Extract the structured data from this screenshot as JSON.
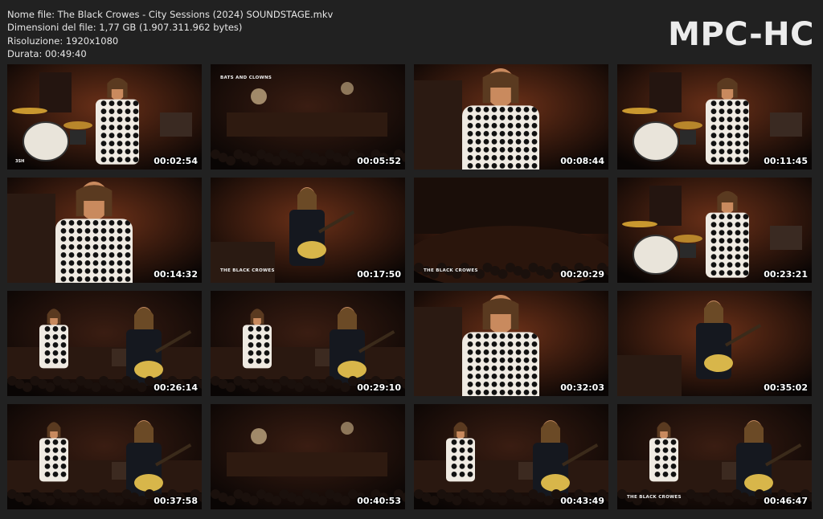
{
  "file_info": {
    "name_line": "Nome file: The Black Crowes - City Sessions (2024) SOUNDSTAGE.mkv",
    "size_line": "Dimensioni del file: 1,77 GB (1.907.311.962 bytes)",
    "resolution_line": "Risoluzione: 1920x1080",
    "duration_line": "Durata: 00:49:40"
  },
  "logo": "MPC-HC",
  "colors": {
    "background": "#212121",
    "text": "#e6e6e6",
    "stage_warm": "#7a3a1e",
    "stage_dark": "#0b0706"
  },
  "thumbnails": [
    {
      "timestamp": "00:02:54",
      "scene": "singer-drums",
      "badge": "3SH"
    },
    {
      "timestamp": "00:05:52",
      "scene": "wide-stage",
      "caption_top": "BATS AND CLOWNS"
    },
    {
      "timestamp": "00:08:44",
      "scene": "singer-closeup"
    },
    {
      "timestamp": "00:11:45",
      "scene": "singer-drums"
    },
    {
      "timestamp": "00:14:32",
      "scene": "singer-closeup"
    },
    {
      "timestamp": "00:17:50",
      "scene": "guitarist",
      "caption_bottom": "THE BLACK CROWES"
    },
    {
      "timestamp": "00:20:29",
      "scene": "crowd",
      "caption_bottom": "THE BLACK CROWES"
    },
    {
      "timestamp": "00:23:21",
      "scene": "singer-drums"
    },
    {
      "timestamp": "00:26:14",
      "scene": "stage-duo"
    },
    {
      "timestamp": "00:29:10",
      "scene": "stage-duo"
    },
    {
      "timestamp": "00:32:03",
      "scene": "singer-closeup"
    },
    {
      "timestamp": "00:35:02",
      "scene": "guitarist"
    },
    {
      "timestamp": "00:37:58",
      "scene": "stage-duo"
    },
    {
      "timestamp": "00:40:53",
      "scene": "wide-stage"
    },
    {
      "timestamp": "00:43:49",
      "scene": "stage-duo"
    },
    {
      "timestamp": "00:46:47",
      "scene": "stage-duo",
      "caption_bottom": "THE BLACK CROWES"
    }
  ]
}
